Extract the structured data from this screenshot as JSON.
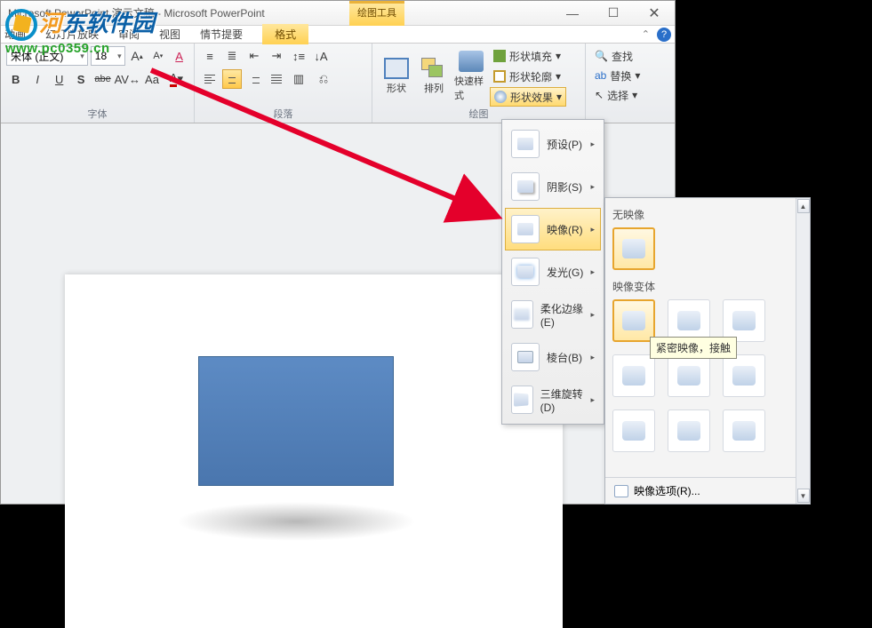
{
  "title": "Microsoft PowerPoint 演示文稿 - Microsoft PowerPoint",
  "contextTab": {
    "group": "绘图工具",
    "tab": "格式"
  },
  "menu": {
    "items": [
      "动画",
      "幻灯片放映",
      "审阅",
      "视图",
      "情节提要"
    ]
  },
  "font": {
    "name": "宋体 (正文)",
    "size": "18",
    "bold": "B",
    "italic": "I",
    "underline": "U",
    "strike": "S",
    "strike2": "abe",
    "spacing": "AV",
    "case": "Aa",
    "grow": "A",
    "shrink": "A",
    "clear": "A",
    "group_label": "字体"
  },
  "para": {
    "group_label": "段落"
  },
  "draw": {
    "shapes": "形状",
    "arrange": "排列",
    "quick": "快速样式",
    "fill": "形状填充",
    "outline": "形状轮廓",
    "effects": "形状效果",
    "find": "查找",
    "replace": "替换",
    "select": "选择",
    "group_label": "绘图"
  },
  "effects_menu": {
    "preset": "预设(P)",
    "shadow": "阴影(S)",
    "reflection": "映像(R)",
    "glow": "发光(G)",
    "soft": "柔化边缘(E)",
    "bevel": "棱台(B)",
    "rotate3d": "三维旋转(D)"
  },
  "reflect": {
    "none_label": "无映像",
    "variants_label": "映像变体",
    "tooltip": "紧密映像，接触",
    "options": "映像选项(R)..."
  },
  "watermark": {
    "text1": "河东软件园",
    "url": "www.pc0359.cn"
  }
}
